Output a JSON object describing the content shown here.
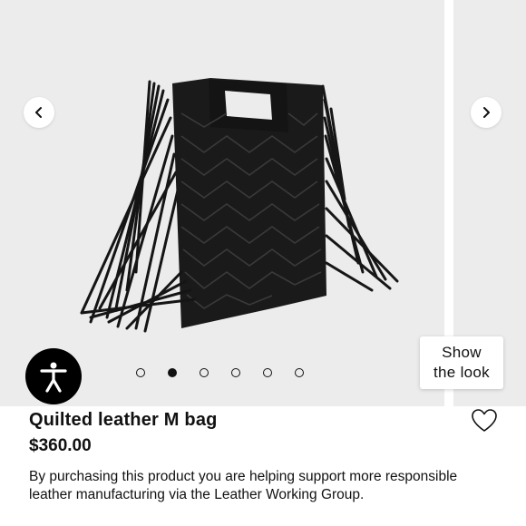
{
  "gallery": {
    "image_alt": "Quilted leather M bag",
    "prev_icon": "chevron-left-icon",
    "next_icon": "chevron-right-icon",
    "dot_count": 6,
    "active_dot_index": 1
  },
  "accessibility": {
    "icon": "accessibility-person-icon"
  },
  "show_look": {
    "label": "Show\nthe look"
  },
  "product": {
    "title": "Quilted leather M bag",
    "price": "$360.00",
    "description": "By purchasing this product you are helping support more responsible leather manufacturing via the Leather Working Group.",
    "favorite_icon": "heart-outline-icon"
  }
}
